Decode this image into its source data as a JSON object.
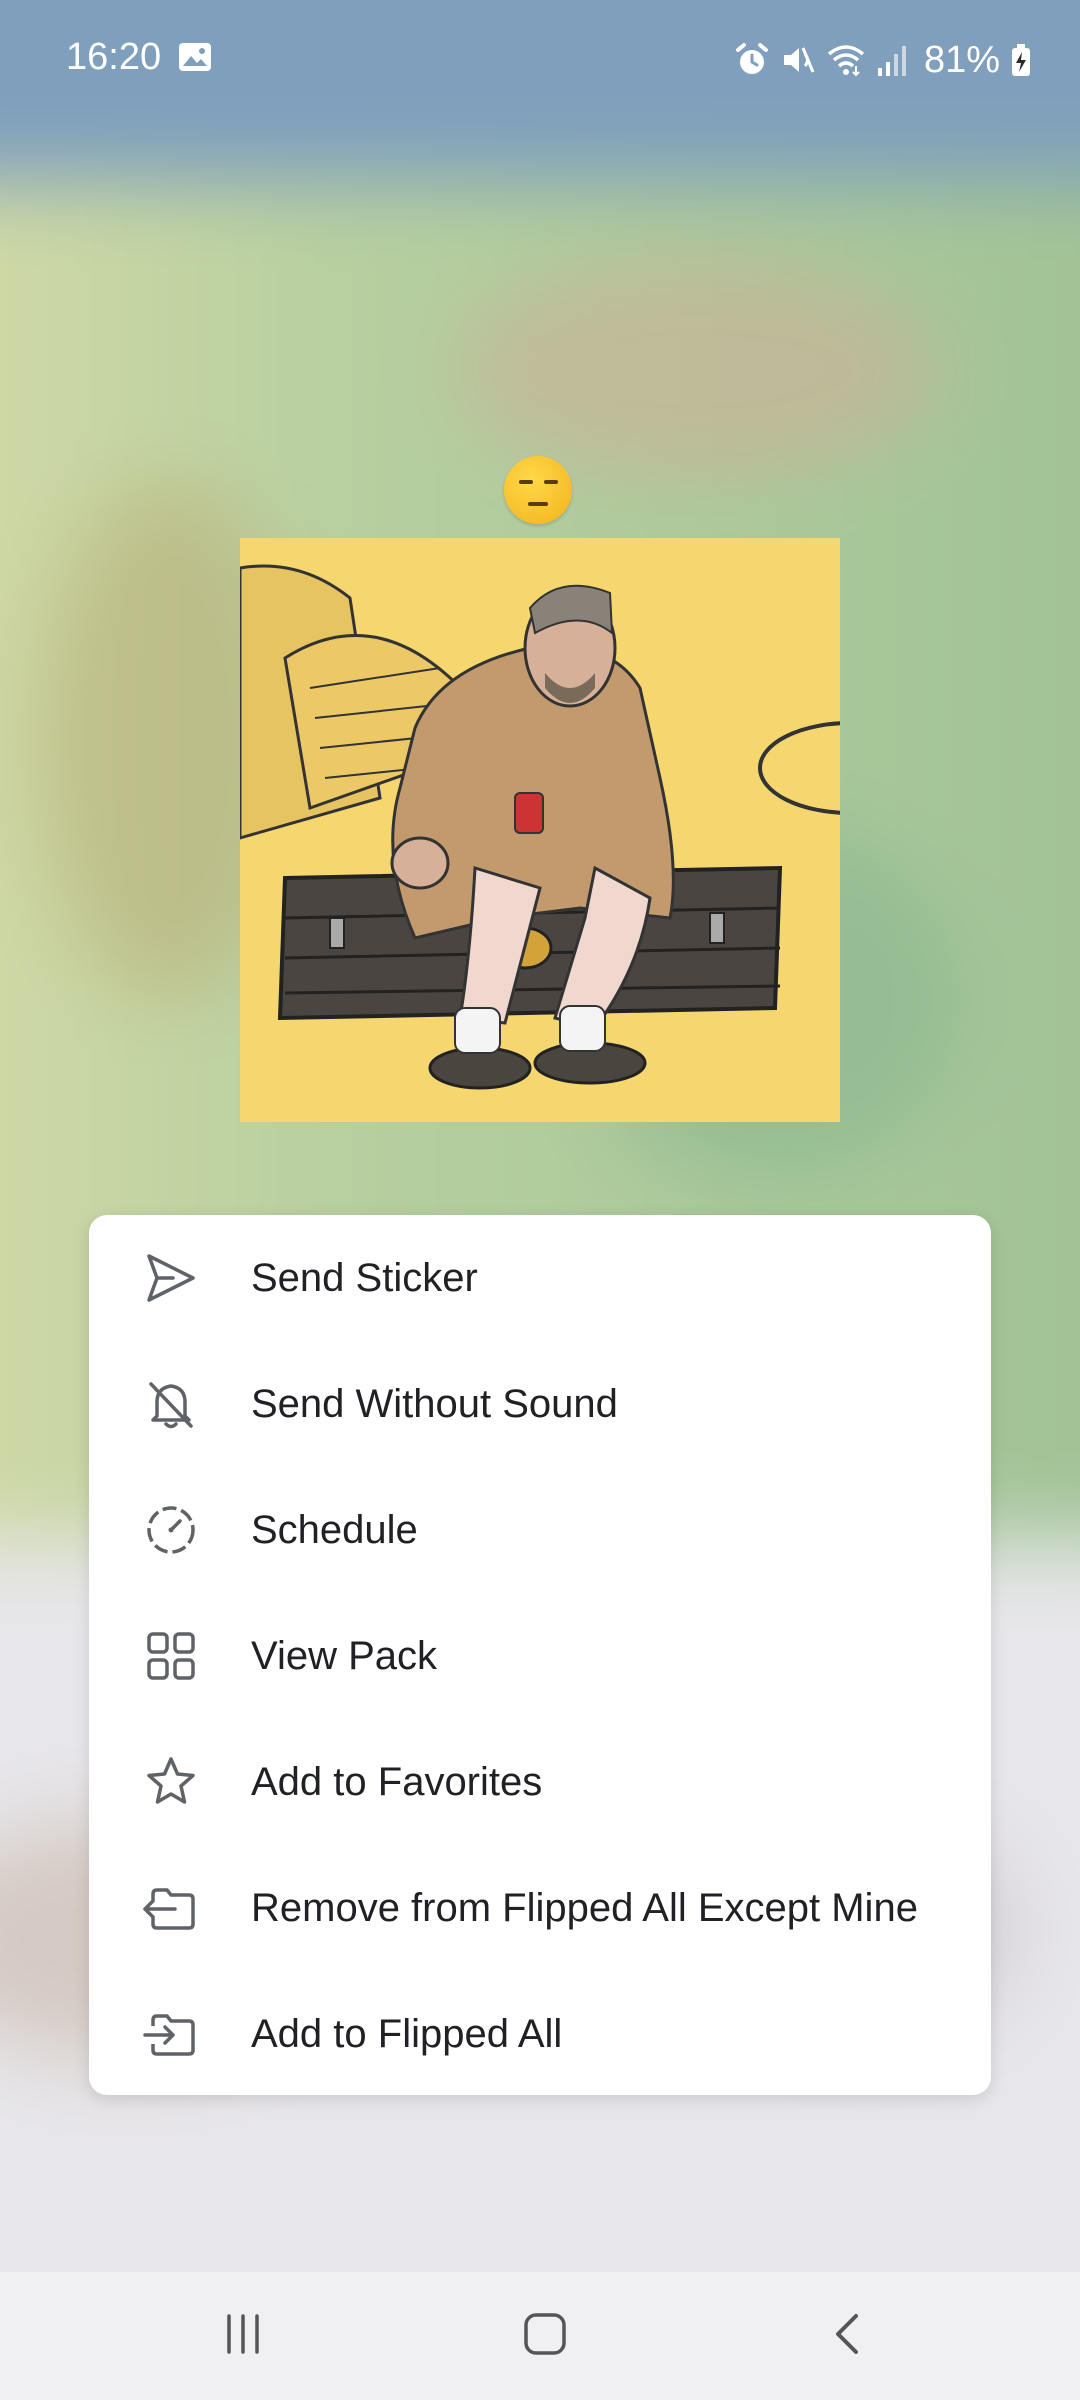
{
  "status_bar": {
    "time": "16:20",
    "battery_percent": "81%",
    "icons": [
      "gallery-icon",
      "alarm-icon",
      "mute-icon",
      "wifi-icon",
      "signal-icon",
      "battery-charging-icon"
    ]
  },
  "sticker": {
    "emoji": "unamused-face-emoji",
    "image": "sticker-image"
  },
  "menu": {
    "items": [
      {
        "label": "Send Sticker",
        "icon": "send-icon"
      },
      {
        "label": "Send Without Sound",
        "icon": "bell-off-icon"
      },
      {
        "label": "Schedule",
        "icon": "schedule-icon"
      },
      {
        "label": "View Pack",
        "icon": "grid-icon"
      },
      {
        "label": "Add to Favorites",
        "icon": "star-icon"
      },
      {
        "label": "Remove from Flipped All Except Mine",
        "icon": "folder-remove-icon"
      },
      {
        "label": "Add to Flipped All",
        "icon": "folder-add-icon"
      }
    ]
  },
  "nav_bar": {
    "buttons": [
      "recent-apps-icon",
      "home-icon",
      "back-icon"
    ]
  },
  "colors": {
    "menu_background": "#ffffff",
    "menu_text": "#202124",
    "icon_stroke": "#5f6368",
    "nav_background": "#f0f0f2"
  }
}
